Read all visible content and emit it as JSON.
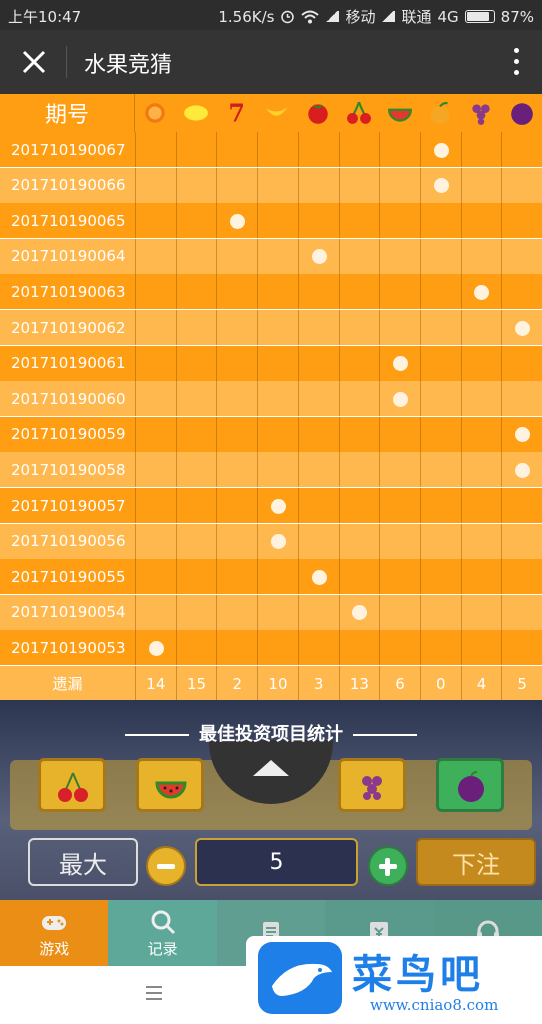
{
  "status_bar": {
    "time": "上午10:47",
    "speed": "1.56K/s",
    "carrier1": "移动",
    "carrier2": "联通",
    "network": "4G",
    "battery": "87%",
    "battery_level": 0.87
  },
  "title_bar": {
    "title": "水果竞猜",
    "close_icon": "close-icon",
    "more_icon": "more-vertical-icon"
  },
  "table": {
    "period_header": "期号",
    "fruit_columns": [
      "orange",
      "lemon",
      "seven",
      "banana",
      "tomato",
      "cherry",
      "watermelon",
      "mango",
      "grape",
      "plum"
    ],
    "rows": [
      {
        "period": "201710190067",
        "hit_column": 7
      },
      {
        "period": "201710190066",
        "hit_column": 7
      },
      {
        "period": "201710190065",
        "hit_column": 2
      },
      {
        "period": "201710190064",
        "hit_column": 4
      },
      {
        "period": "201710190063",
        "hit_column": 8
      },
      {
        "period": "201710190062",
        "hit_column": 9
      },
      {
        "period": "201710190061",
        "hit_column": 6
      },
      {
        "period": "201710190060",
        "hit_column": 6
      },
      {
        "period": "201710190059",
        "hit_column": 9
      },
      {
        "period": "201710190058",
        "hit_column": 9
      },
      {
        "period": "201710190057",
        "hit_column": 3
      },
      {
        "period": "201710190056",
        "hit_column": 3
      },
      {
        "period": "201710190055",
        "hit_column": 4
      },
      {
        "period": "201710190054",
        "hit_column": 5
      },
      {
        "period": "201710190053",
        "hit_column": 0
      }
    ],
    "miss_label": "遗漏",
    "miss_values": [
      "14",
      "15",
      "2",
      "10",
      "3",
      "13",
      "6",
      "0",
      "4",
      "5"
    ]
  },
  "game": {
    "stats_title": "最佳投资项目统计",
    "max_button": "最大",
    "quantity": "5",
    "bet_button": "下注",
    "minus_icon": "minus-icon",
    "plus_icon": "plus-icon"
  },
  "nav": {
    "tabs": [
      {
        "label": "游戏",
        "icon": "gamepad-icon",
        "active": true
      },
      {
        "label": "记录",
        "icon": "search-icon",
        "active": false
      },
      {
        "label": "",
        "icon": "notepad-icon",
        "active": false
      },
      {
        "label": "",
        "icon": "wallet-icon",
        "active": false
      },
      {
        "label": "",
        "icon": "headset-icon",
        "active": false
      }
    ]
  },
  "watermark": {
    "name": "菜鸟吧",
    "url": "www.cniao8.com"
  },
  "colors": {
    "row_dark": "#ff9d13",
    "row_light": "#ffb84d",
    "active_tab": "#ea8e16",
    "title_bar": "#343434"
  }
}
